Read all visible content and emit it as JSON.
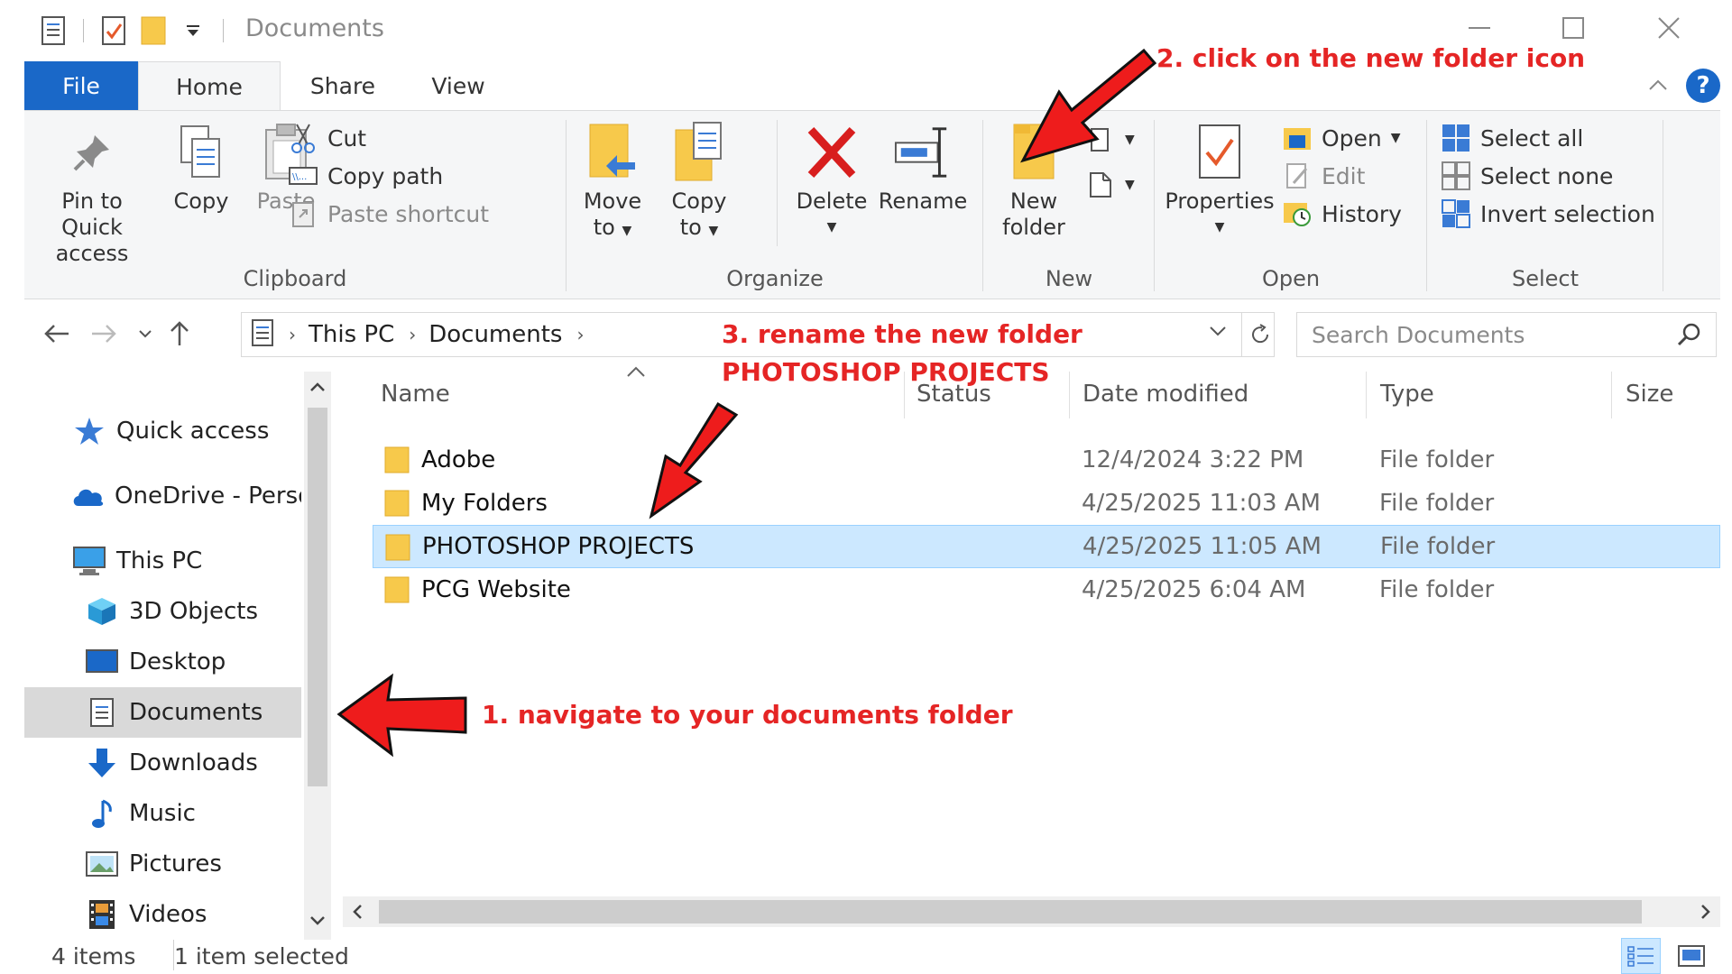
{
  "window": {
    "title": "Documents",
    "controls": {
      "minimize": "—",
      "maximize": "☐",
      "close": "✕"
    }
  },
  "tabs": {
    "file": "File",
    "home": "Home",
    "share": "Share",
    "view": "View"
  },
  "ribbon": {
    "clipboard": {
      "label": "Clipboard",
      "pin": [
        "Pin to Quick",
        "access"
      ],
      "copy": "Copy",
      "paste": "Paste",
      "cut": "Cut",
      "copy_path": "Copy path",
      "paste_shortcut": "Paste shortcut"
    },
    "organize": {
      "label": "Organize",
      "move_to": [
        "Move",
        "to"
      ],
      "copy_to": [
        "Copy",
        "to"
      ],
      "delete": "Delete",
      "rename": "Rename"
    },
    "new": {
      "label": "New",
      "new_folder": [
        "New",
        "folder"
      ]
    },
    "open": {
      "label": "Open",
      "properties": "Properties",
      "open": "Open",
      "edit": "Edit",
      "history": "History"
    },
    "select": {
      "label": "Select",
      "select_all": "Select all",
      "select_none": "Select none",
      "invert": "Invert selection"
    }
  },
  "address": {
    "crumbs": [
      "This PC",
      "Documents"
    ],
    "search_placeholder": "Search Documents"
  },
  "nav": {
    "quick_access": "Quick access",
    "onedrive": "OneDrive - Perso",
    "this_pc": "This PC",
    "objects_3d": "3D Objects",
    "desktop": "Desktop",
    "documents": "Documents",
    "downloads": "Downloads",
    "music": "Music",
    "pictures": "Pictures",
    "videos": "Videos"
  },
  "columns": {
    "name": "Name",
    "status": "Status",
    "date": "Date modified",
    "type": "Type",
    "size": "Size"
  },
  "files": [
    {
      "name": "Adobe",
      "date": "12/4/2024 3:22 PM",
      "type": "File folder"
    },
    {
      "name": "My Folders",
      "date": "4/25/2025 11:03 AM",
      "type": "File folder"
    },
    {
      "name": "PHOTOSHOP PROJECTS",
      "date": "4/25/2025 11:05 AM",
      "type": "File folder"
    },
    {
      "name": "PCG Website",
      "date": "4/25/2025 6:04 AM",
      "type": "File folder"
    }
  ],
  "status": {
    "items": "4 items",
    "selected": "1 item selected"
  },
  "annotations": {
    "step1": "1. navigate to your documents folder",
    "step2": "2. click on the new folder icon",
    "step3_line1": "3. rename the new folder",
    "step3_line2": "PHOTOSHOP PROJECTS"
  },
  "colors": {
    "accent": "#1a68c8",
    "annotation": "#e52525",
    "selection": "#cce8ff",
    "folder": "#f7c94b"
  }
}
